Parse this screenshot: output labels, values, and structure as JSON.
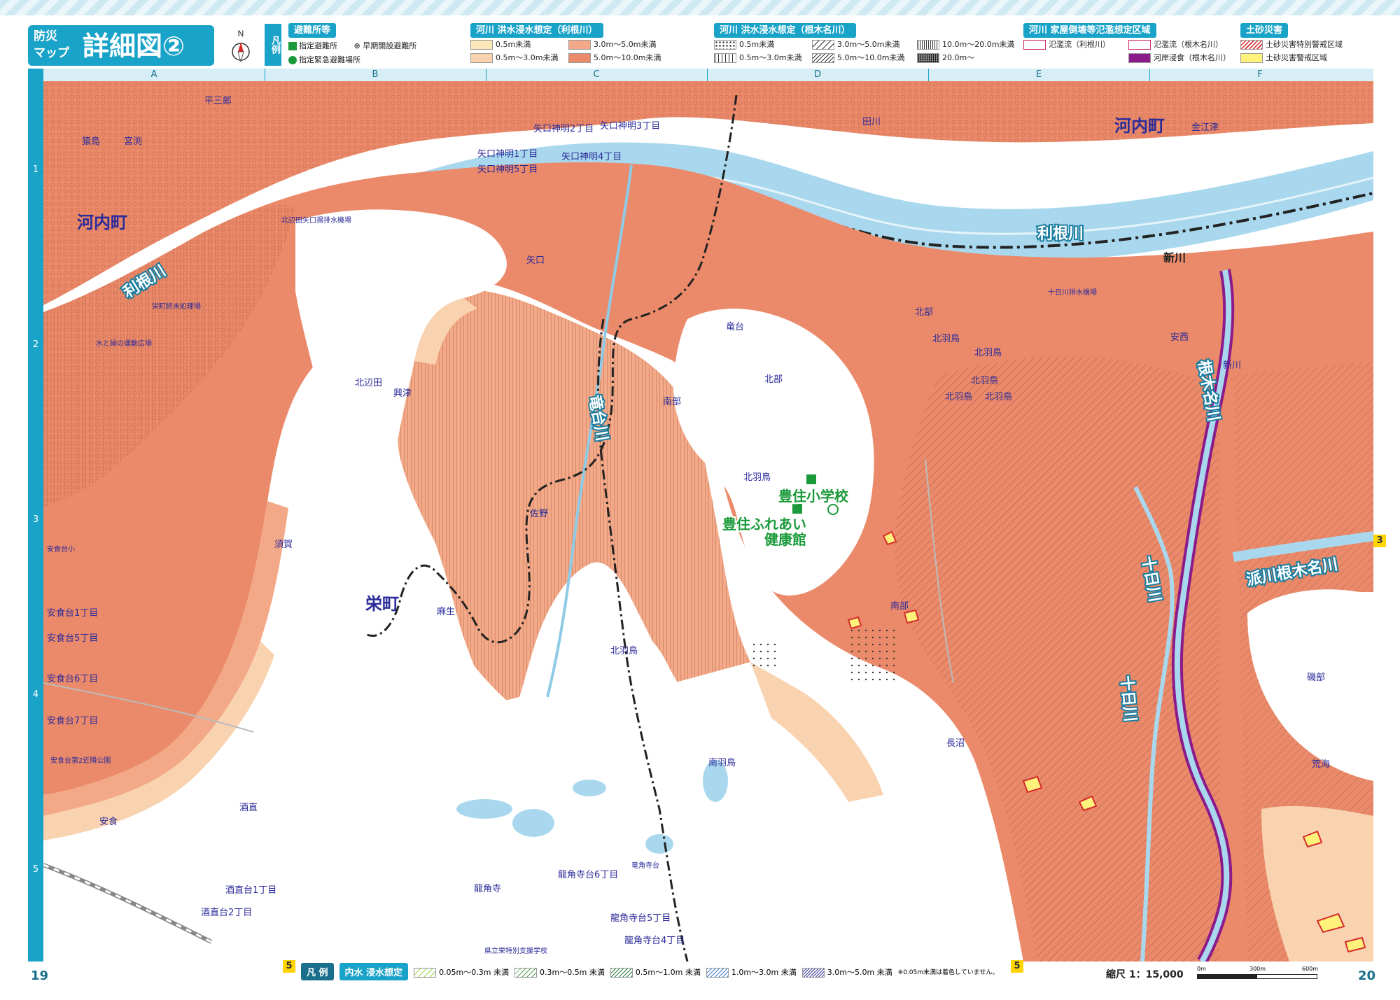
{
  "header": {
    "title_small": "防災\nマップ",
    "title_main": "詳細図②",
    "compass_letter": "N",
    "legend_vertical": "凡例"
  },
  "legend": {
    "shelters": {
      "heading": "避難所等",
      "items": [
        "指定避難所",
        "指定緊急避難場所",
        "早期開設避難所"
      ]
    },
    "tone_flood": {
      "heading": "河川 洪水浸水想定（利根川）",
      "items": [
        {
          "label": "0.5m未満",
          "color": "#fbe8b6"
        },
        {
          "label": "0.5m～3.0m未満",
          "color": "#f8d2ae"
        },
        {
          "label": "3.0m～5.0m未満",
          "color": "#f2aa88"
        },
        {
          "label": "5.0m～10.0m未満",
          "color": "#ea8a68"
        }
      ]
    },
    "nekina_flood": {
      "heading": "河川 洪水浸水想定（根木名川）",
      "items": [
        "0.5m未満",
        "0.5m～3.0m未満",
        "3.0m～5.0m未満",
        "5.0m～10.0m未満",
        "10.0m～20.0m未満",
        "20.0m～"
      ]
    },
    "collapse": {
      "heading": "河川 家屋倒壊等氾濫想定区域",
      "items": [
        "氾濫流（利根川）",
        "氾濫流（根木名川）",
        "河岸浸食（根木名川）"
      ]
    },
    "landslide": {
      "heading": "土砂災害",
      "items": [
        "土砂災害特別警戒区域",
        "土砂災害警戒区域"
      ]
    }
  },
  "grid": {
    "columns": [
      "A",
      "B",
      "C",
      "D",
      "E",
      "F"
    ],
    "rows": [
      "1",
      "2",
      "3",
      "4",
      "5"
    ]
  },
  "map": {
    "towns_big": [
      "河内町",
      "河内町",
      "栄町"
    ],
    "rivers": [
      "利根川",
      "利根川",
      "竜台川",
      "根木名川",
      "十日川",
      "十日川",
      "派川根木名川"
    ],
    "shelters_on_map": [
      "豊住小学校",
      "豊住ふれあい\n健康館"
    ],
    "station": "新川",
    "places": [
      "平三郎",
      "猿島",
      "宮渕",
      "金江津",
      "田川",
      "矢口神明2丁目",
      "矢口神明3丁目",
      "矢口神明1丁目",
      "矢口神明4丁目",
      "矢口神明5丁目",
      "矢口",
      "北辺田",
      "興津",
      "南部",
      "竜台",
      "北部",
      "北羽鳥",
      "北部",
      "北羽鳥",
      "北羽鳥",
      "北羽鳥",
      "北羽鳥",
      "北羽鳥",
      "安西",
      "新川",
      "佐野",
      "須賀",
      "麻生",
      "北羽鳥",
      "南部",
      "長沼",
      "南羽鳥",
      "酒直",
      "安食",
      "龍角寺",
      "龍角寺台6丁目",
      "龍角寺台5丁目",
      "龍角寺台4丁目",
      "酒直台1丁目",
      "酒直台2丁目",
      "安食台1丁目",
      "安食台5丁目",
      "安食台6丁目",
      "安食台7丁目",
      "磯部",
      "荒海",
      "安食台小",
      "安食台第2近隣公園",
      "県立栄特別支援学校",
      "竜角寺台",
      "水と緑の運動広場",
      "栄町終末処理場",
      "北辺田矢口揚排水機場",
      "十日川排水機場"
    ],
    "map_colors": {
      "river": "#a9d8ee",
      "levee": "#ffffff",
      "flood_deep": "#eb8a6a",
      "flood_mid": "#f3a987",
      "flood_shallow": "#f9d3b0",
      "flood_light": "#fbe7b8",
      "nekina_band": "#8b1a8b"
    }
  },
  "footer": {
    "page_left": "19",
    "page_right": "20",
    "badge_left": "5",
    "badge_mid": "5",
    "badge_right": "3",
    "legend_tag": "凡 例",
    "inundation_tag": "内水 浸水想定",
    "inundation_items": [
      "0.05m～0.3m 未満",
      "0.3m～0.5m 未満",
      "0.5m～1.0m 未満",
      "1.0m～3.0m 未満",
      "3.0m～5.0m 未満"
    ],
    "note": "※0.05m未満は着色していません。",
    "scale_label": "縮尺 1：15,000",
    "scale_ticks": [
      "0m",
      "300m",
      "600m"
    ]
  }
}
